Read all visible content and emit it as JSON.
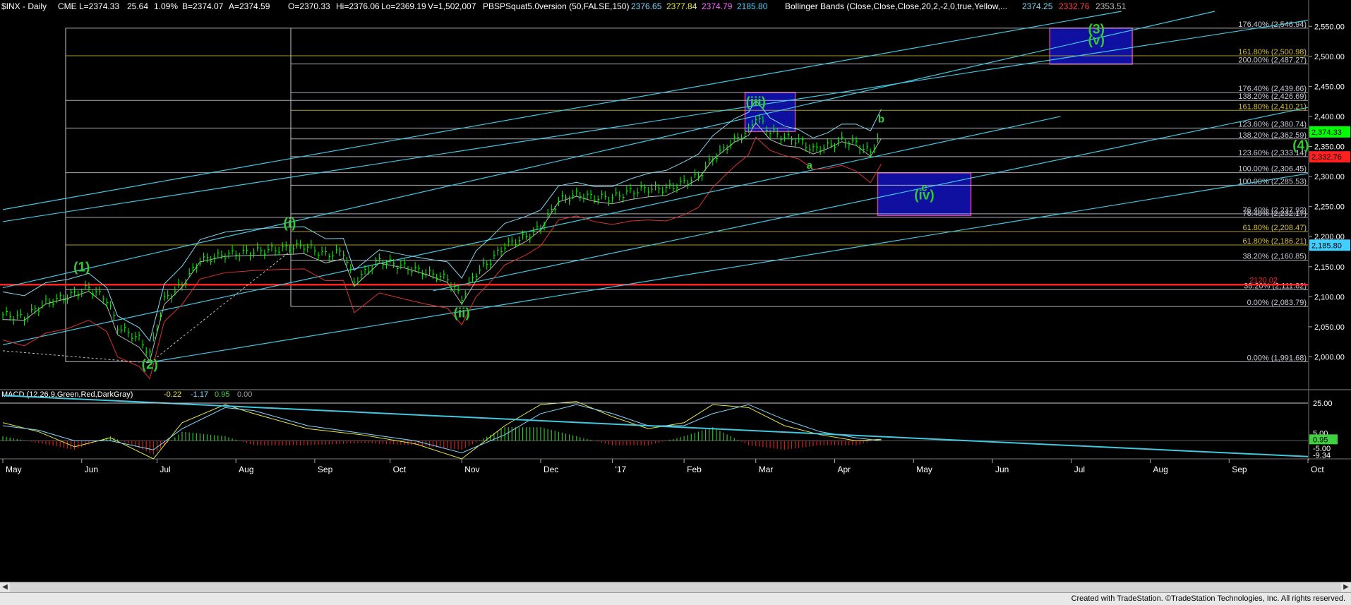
{
  "header": {
    "symbol": "$INX - Daily",
    "exchange": "CME",
    "last": "L=2374.33",
    "change": "25.64",
    "change_pct": "1.09%",
    "bid": "B=2374.07",
    "ask": "A=2374.59",
    "open": "O=2370.33",
    "high": "Hi=2376.06",
    "low": "Lo=2369.19",
    "volume": "V=1,502,007",
    "indicator": "PBSPSquat5.0version (50,FALSE,150)",
    "ind_v1": "2376.65",
    "ind_v2": "2377.84",
    "ind_v3": "2374.79",
    "ind_v4": "2185.80",
    "bb_label": "Bollinger Bands (Close,Close,Close,20,2,-2,0,true,Yellow,...",
    "bb_v1": "2374.25",
    "bb_v2": "2332.76",
    "bb_v3": "2353.51"
  },
  "macd_header": {
    "label": "MACD (12,26,9,Green,Red,DarkGray)",
    "v1": "-0.22",
    "v2": "-1.17",
    "v3": "0.95",
    "v4": "0.00"
  },
  "footer": {
    "credit": "Created with TradeStation. ©TradeStation Technologies, Inc. All rights reserved."
  },
  "colors": {
    "price_bar": "#00ff00",
    "fib_line": "#c8c8d2",
    "gold_line": "#c8b428",
    "channel": "#40c8e0",
    "bb_mid": "#b8b8b8",
    "bb_upper": "#80d8f0",
    "bb_lower": "#e03030",
    "support": "#ff2020",
    "wave_label": "#32c832",
    "target_box": "#1010a0",
    "target_border": "#d040a0"
  },
  "chart_data": {
    "type": "line",
    "title": "$INX - Daily",
    "ylim": [
      1950,
      2575
    ],
    "xlim_months": [
      "May",
      "Oct"
    ],
    "x_axis_labels": [
      "May",
      "Jun",
      "Jul",
      "Aug",
      "Sep",
      "Oct",
      "Nov",
      "Dec",
      "'17",
      "Feb",
      "Mar",
      "Apr",
      "May",
      "Jun",
      "Jul",
      "Aug",
      "Sep",
      "Oct"
    ],
    "x_axis_index": [
      0,
      22,
      43,
      65,
      87,
      108,
      128,
      150,
      170,
      190,
      210,
      232,
      254,
      276,
      298,
      320,
      342,
      364
    ],
    "y_ticks": [
      2000,
      2050,
      2100,
      2150,
      2200,
      2250,
      2300,
      2350,
      2400,
      2450,
      2500,
      2550
    ],
    "y_tick_labels": [
      "2,000.00",
      "2,050.00",
      "2,100.00",
      "2,150.00",
      "2,200.00",
      "2,250.00",
      "2,300.00",
      "2,350.00",
      "2,400.00",
      "2,450.00",
      "2,500.00",
      "2,550.00"
    ],
    "price_series": {
      "name": "$INX",
      "index": [
        0,
        6,
        12,
        18,
        24,
        29,
        32,
        38,
        41,
        45,
        50,
        55,
        62,
        70,
        78,
        84,
        90,
        95,
        98,
        105,
        112,
        118,
        124,
        128,
        132,
        136,
        140,
        146,
        150,
        155,
        160,
        165,
        170,
        175,
        180,
        185,
        190,
        194,
        198,
        204,
        208,
        210,
        214,
        218,
        222,
        226,
        230,
        234,
        238,
        242,
        245
      ],
      "close": [
        2070,
        2065,
        2090,
        2100,
        2115,
        2095,
        2050,
        2030,
        2005,
        2095,
        2120,
        2160,
        2170,
        2175,
        2180,
        2185,
        2170,
        2175,
        2125,
        2160,
        2150,
        2140,
        2130,
        2098,
        2140,
        2160,
        2185,
        2200,
        2215,
        2260,
        2270,
        2265,
        2265,
        2275,
        2280,
        2280,
        2290,
        2300,
        2330,
        2360,
        2375,
        2400,
        2375,
        2365,
        2360,
        2345,
        2350,
        2360,
        2355,
        2340,
        2374
      ]
    },
    "fib_levels": [
      {
        "label": "176.40% (2,546.94)",
        "value": 2546.94
      },
      {
        "label": "161.80% (2,500.98)",
        "value": 2500.98
      },
      {
        "label": "200.00% (2,487.27)",
        "value": 2487.27
      },
      {
        "label": "176.40% (2,439.66)",
        "value": 2439.66
      },
      {
        "label": "138.20% (2,426.69)",
        "value": 2426.69
      },
      {
        "label": "161.80% (2,410.21)",
        "value": 2410.21
      },
      {
        "label": "123.60% (2,380.74)",
        "value": 2380.74
      },
      {
        "label": "138.20% (2,362.59)",
        "value": 2362.59
      },
      {
        "label": "123.60% (2,333.14)",
        "value": 2333.14
      },
      {
        "label": "100.00% (2,306.45)",
        "value": 2306.45
      },
      {
        "label": "100.00% (2,285.53)",
        "value": 2285.53
      },
      {
        "label": "76.40% (2,237.92)",
        "value": 2237.92
      },
      {
        "label": "76.40% (2,232.17)",
        "value": 2232.17
      },
      {
        "label": "61.80% (2,208.47)",
        "value": 2208.47
      },
      {
        "label": "61.80% (2,186.21)",
        "value": 2186.21
      },
      {
        "label": "38.20% (2,160.85)",
        "value": 2160.85
      },
      {
        "label": "38.20% (2,111.82)",
        "value": 2111.82
      },
      {
        "label": "0.00% (2,083.79)",
        "value": 2083.79
      },
      {
        "label": "0.00% (1,991.68)",
        "value": 1991.68
      }
    ],
    "support_line": {
      "label": "2120.02",
      "value": 2120.02
    },
    "price_tags": [
      {
        "label": "2,374.33",
        "value": 2374.33,
        "color": "#00ff00"
      },
      {
        "label": "2,332.76",
        "value": 2332.76,
        "color": "#ff2020"
      },
      {
        "label": "2,185.80",
        "value": 2185.8,
        "color": "#40d0ff"
      }
    ],
    "wave_labels": [
      {
        "text": "(1)",
        "index": 22,
        "value": 2142
      },
      {
        "text": "(2)",
        "index": 41,
        "value": 1980
      },
      {
        "text": "(i)",
        "index": 80,
        "value": 2215
      },
      {
        "text": "(ii)",
        "index": 128,
        "value": 2066
      },
      {
        "text": "(iii)",
        "index": 210,
        "value": 2417
      },
      {
        "text": "a",
        "index": 225,
        "value": 2313
      },
      {
        "text": "b",
        "index": 245,
        "value": 2390
      },
      {
        "text": "c",
        "index": 257,
        "value": 2276
      },
      {
        "text": "(iv)",
        "index": 257,
        "value": 2262
      },
      {
        "text": "(4)",
        "index": 362,
        "value": 2345
      },
      {
        "text": "(3)",
        "index": 305,
        "value": 2538
      },
      {
        "text": "(v)",
        "index": 305,
        "value": 2520
      }
    ],
    "target_boxes": [
      {
        "name": "iv-box",
        "x0": 244,
        "x1": 270,
        "y0": 2235,
        "y1": 2306
      },
      {
        "name": "v-box",
        "x0": 292,
        "x1": 315,
        "y0": 2487,
        "y1": 2547
      },
      {
        "name": "iii-box",
        "x0": 207,
        "x1": 221,
        "y0": 2375,
        "y1": 2440
      }
    ],
    "macd": {
      "name": "MACD",
      "y_tick_labels": [
        "25.00",
        "5.00",
        "0.95",
        "-5.00",
        "-9.34"
      ],
      "y_ticks": [
        25,
        5,
        0.95,
        -5,
        -9.34
      ],
      "ylim": [
        -12,
        32
      ],
      "index": [
        0,
        10,
        20,
        30,
        42,
        50,
        62,
        70,
        85,
        100,
        115,
        128,
        140,
        150,
        160,
        170,
        180,
        190,
        198,
        208,
        218,
        228,
        238,
        245
      ],
      "macd": [
        12,
        6,
        -4,
        2,
        -12,
        12,
        24,
        18,
        8,
        4,
        -2,
        -12,
        10,
        24,
        26,
        16,
        8,
        12,
        24,
        22,
        10,
        4,
        0,
        1
      ],
      "signal": [
        10,
        7,
        0,
        0,
        -6,
        8,
        22,
        20,
        10,
        5,
        0,
        -8,
        4,
        18,
        24,
        18,
        10,
        10,
        18,
        24,
        14,
        6,
        2,
        0
      ]
    }
  }
}
